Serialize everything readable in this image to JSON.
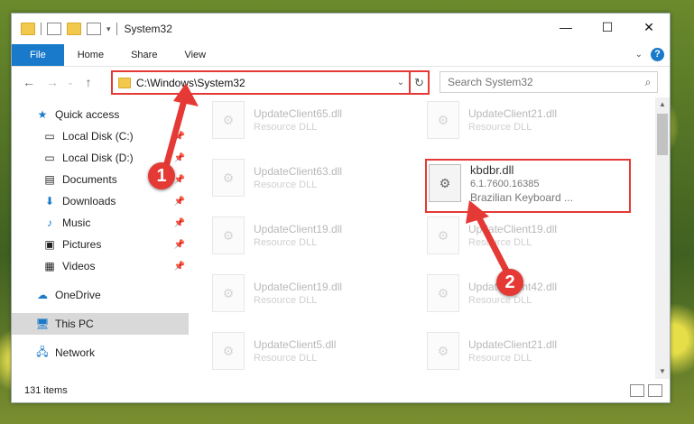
{
  "window": {
    "title": "System32",
    "controls": {
      "minimize": "—",
      "maximize": "☐",
      "close": "✕"
    }
  },
  "ribbon": {
    "file": "File",
    "home": "Home",
    "share": "Share",
    "view": "View",
    "help": "?"
  },
  "address": {
    "path": "C:\\Windows\\System32"
  },
  "search": {
    "placeholder": "Search System32"
  },
  "nav": [
    {
      "label": "Quick access",
      "icon": "star-icon"
    },
    {
      "label": "Local Disk (C:)",
      "icon": "drive-icon"
    },
    {
      "label": "Local Disk (D:)",
      "icon": "drive-icon"
    },
    {
      "label": "Documents",
      "icon": "documents-icon"
    },
    {
      "label": "Downloads",
      "icon": "download-icon"
    },
    {
      "label": "Music",
      "icon": "music-icon"
    },
    {
      "label": "Pictures",
      "icon": "pictures-icon"
    },
    {
      "label": "Videos",
      "icon": "videos-icon"
    },
    {
      "label": "OneDrive",
      "icon": "cloud-icon"
    },
    {
      "label": "This PC",
      "icon": "computer-icon"
    },
    {
      "label": "Network",
      "icon": "network-icon"
    }
  ],
  "files": [
    {
      "name": "UpdateClient65.dll",
      "type": "Resource DLL"
    },
    {
      "name": "UpdateClient21.dll",
      "type": "Resource DLL"
    },
    {
      "name": "UpdateClient63.dll",
      "type": "Resource DLL"
    },
    {
      "name": "kbdbr.dll",
      "version": "6.1.7600.16385",
      "desc": "Brazilian Keyboard ..."
    },
    {
      "name": "UpdateClient19.dll",
      "type": "Resource DLL"
    },
    {
      "name": "UpdateClient19.dll",
      "type": "Resource DLL"
    },
    {
      "name": "UpdateClient19.dll",
      "type": "Resource DLL"
    },
    {
      "name": "UpdateClient42.dll",
      "type": "Resource DLL"
    },
    {
      "name": "UpdateClient5.dll",
      "type": "Resource DLL"
    },
    {
      "name": "UpdateClient21.dll",
      "type": "Resource DLL"
    }
  ],
  "status": {
    "count": "131 items"
  },
  "annotations": {
    "step1": "1",
    "step2": "2"
  },
  "colors": {
    "accent": "#1979ca",
    "highlight": "#e53935"
  }
}
